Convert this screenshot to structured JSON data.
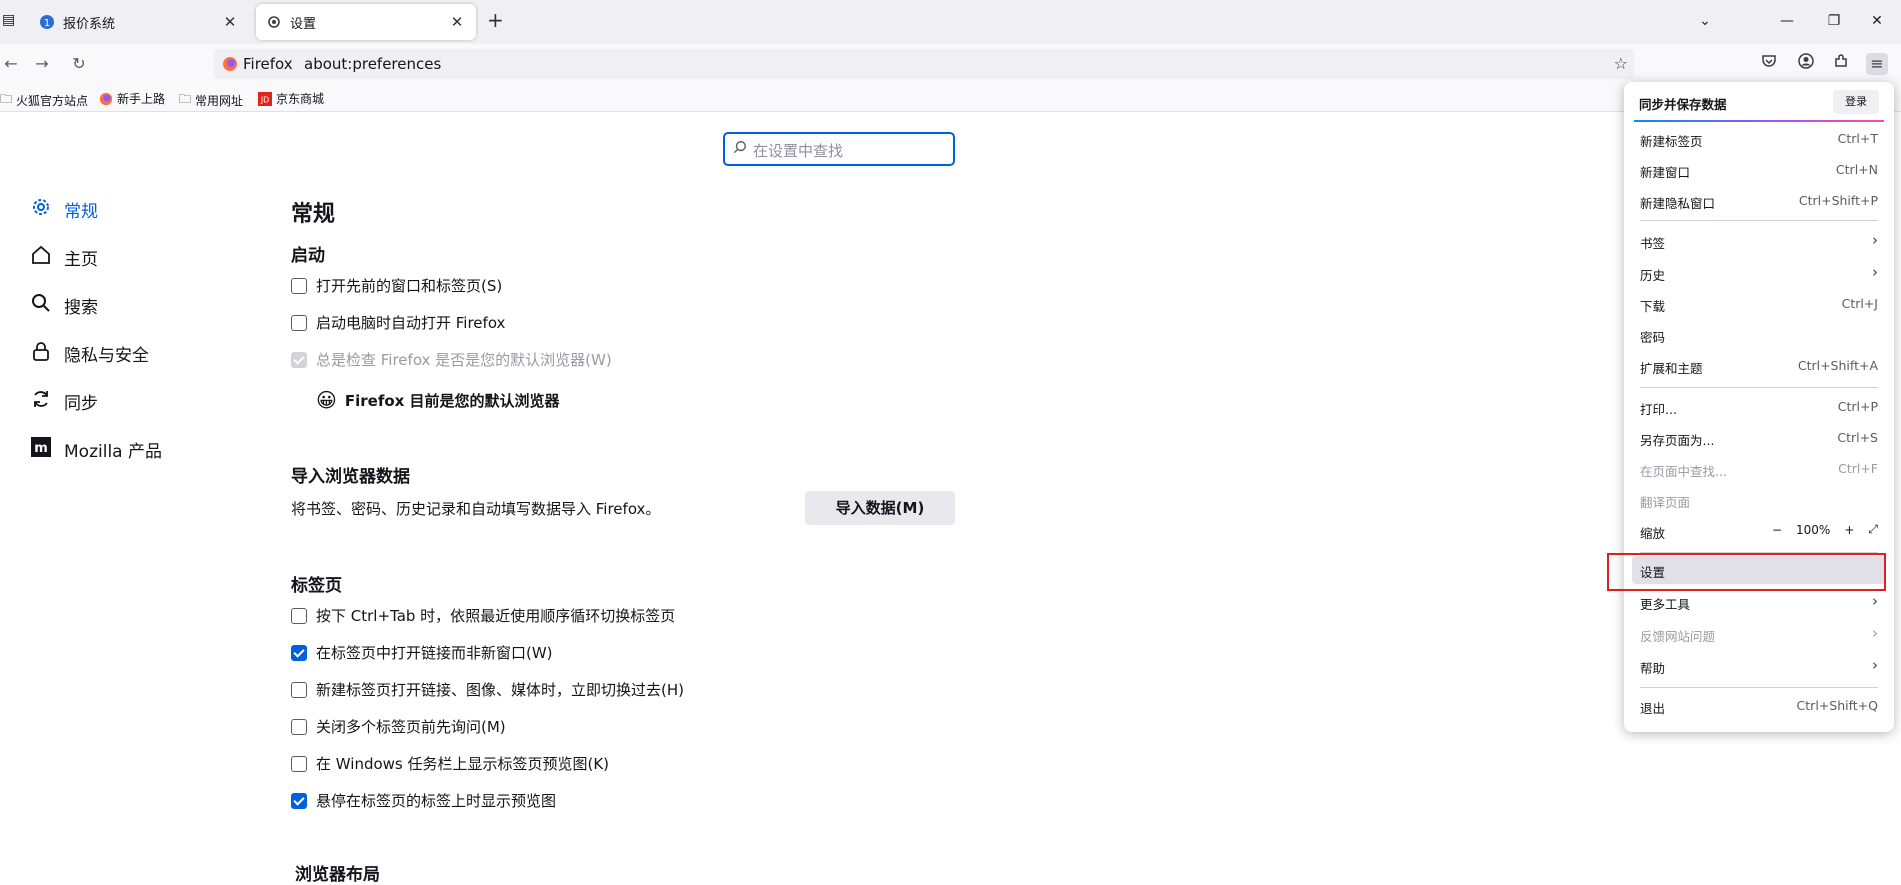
{
  "tabs": [
    {
      "title": "报价系统"
    },
    {
      "title": "设置"
    }
  ],
  "toolbar": {
    "identity_label": "Firefox",
    "url": "about:preferences"
  },
  "bookmarks": [
    {
      "label": "火狐官方站点",
      "icon": "folder-icon"
    },
    {
      "label": "新手上路",
      "icon": "firefox-icon"
    },
    {
      "label": "常用网址",
      "icon": "folder-icon"
    },
    {
      "label": "京东商城",
      "icon": "jd-icon"
    }
  ],
  "search": {
    "placeholder": "在设置中查找"
  },
  "sidebar": {
    "items": [
      {
        "label": "常规",
        "icon": "gear-icon",
        "active": true
      },
      {
        "label": "主页",
        "icon": "home-icon"
      },
      {
        "label": "搜索",
        "icon": "search-icon"
      },
      {
        "label": "隐私与安全",
        "icon": "lock-icon"
      },
      {
        "label": "同步",
        "icon": "sync-icon"
      },
      {
        "label": "Mozilla 产品",
        "icon": "mozilla-icon"
      }
    ]
  },
  "main": {
    "title": "常规",
    "startup": {
      "heading": "启动",
      "opt_restore": "打开先前的窗口和标签页(S)",
      "opt_autostart": "启动电脑时自动打开 Firefox",
      "opt_default_check": "总是检查 Firefox 是否是您的默认浏览器(W)",
      "default_status": "Firefox 目前是您的默认浏览器"
    },
    "import": {
      "heading": "导入浏览器数据",
      "desc": "将书签、密码、历史记录和自动填写数据导入 Firefox。",
      "button": "导入数据(M)"
    },
    "tabs_section": {
      "heading": "标签页",
      "opts": [
        {
          "label": "按下 Ctrl+Tab 时，依照最近使用顺序循环切换标签页",
          "checked": false
        },
        {
          "label": "在标签页中打开链接而非新窗口(W)",
          "checked": true
        },
        {
          "label": "新建标签页打开链接、图像、媒体时，立即切换过去(H)",
          "checked": false
        },
        {
          "label": "关闭多个标签页前先询问(M)",
          "checked": false
        },
        {
          "label": "在 Windows 任务栏上显示标签页预览图(K)",
          "checked": false
        },
        {
          "label": "悬停在标签页的标签上时显示预览图",
          "checked": true
        }
      ]
    },
    "layout_heading": "浏览器布局"
  },
  "appmenu": {
    "sync_title": "同步并保存数据",
    "login": "登录",
    "new_tab": {
      "label": "新建标签页",
      "shortcut": "Ctrl+T"
    },
    "new_window": {
      "label": "新建窗口",
      "shortcut": "Ctrl+N"
    },
    "new_private": {
      "label": "新建隐私窗口",
      "shortcut": "Ctrl+Shift+P"
    },
    "bookmarks": {
      "label": "书签"
    },
    "history": {
      "label": "历史"
    },
    "downloads": {
      "label": "下载",
      "shortcut": "Ctrl+J"
    },
    "passwords": {
      "label": "密码"
    },
    "addons": {
      "label": "扩展和主题",
      "shortcut": "Ctrl+Shift+A"
    },
    "print": {
      "label": "打印...",
      "shortcut": "Ctrl+P"
    },
    "save_page": {
      "label": "另存页面为...",
      "shortcut": "Ctrl+S"
    },
    "find": {
      "label": "在页面中查找...",
      "shortcut": "Ctrl+F"
    },
    "translate": {
      "label": "翻译页面"
    },
    "zoom": {
      "label": "缩放",
      "value": "100%",
      "minus": "−",
      "plus": "+"
    },
    "settings": {
      "label": "设置"
    },
    "more_tools": {
      "label": "更多工具"
    },
    "report": {
      "label": "反馈网站问题"
    },
    "help": {
      "label": "帮助"
    },
    "quit": {
      "label": "退出",
      "shortcut": "Ctrl+Shift+Q"
    }
  },
  "colors": {
    "accent": "#0061e0",
    "highlight_box": "#e02020"
  }
}
